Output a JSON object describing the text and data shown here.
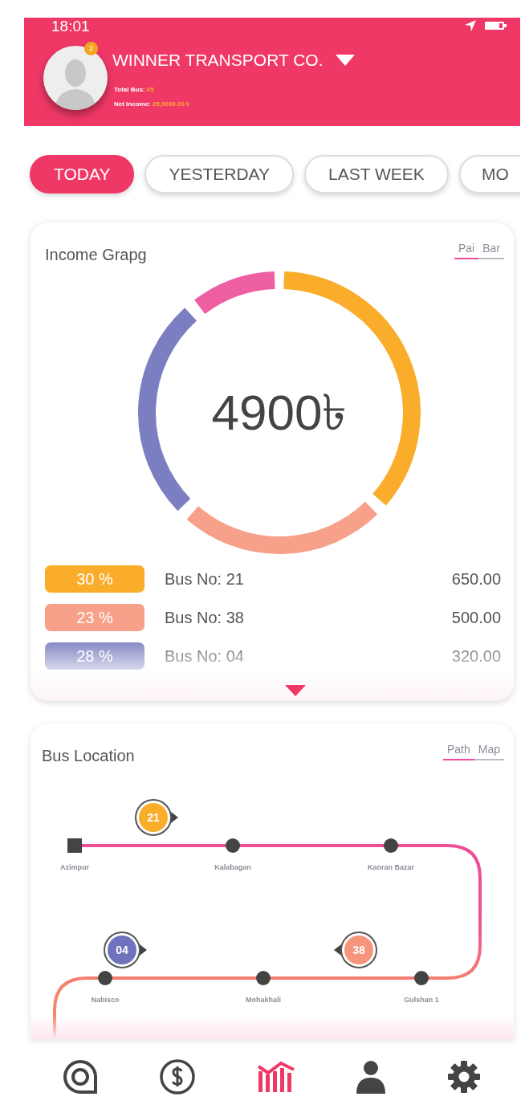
{
  "status_bar": {
    "time": "18:01"
  },
  "header": {
    "company": "WINNER TRANSPORT CO.",
    "notification_count": "2",
    "total_bus_label": "Total Bus:",
    "total_bus": "05",
    "net_income_label": "Net Income:",
    "net_income": "25,0000.00 ৳"
  },
  "period_tabs": [
    {
      "label": "TODAY",
      "selected": true
    },
    {
      "label": "YESTERDAY",
      "selected": false
    },
    {
      "label": "LAST WEEK",
      "selected": false
    },
    {
      "label": "MO",
      "selected": false
    }
  ],
  "income_card": {
    "title": "Income Grapg",
    "view_toggle": [
      {
        "label": "Pai",
        "selected": true
      },
      {
        "label": "Bar",
        "selected": false
      }
    ],
    "total": "4900৳",
    "legend": [
      {
        "percent": "30 %",
        "bus": "Bus No: 21",
        "amount": "650.00",
        "color": "#f9ad2b"
      },
      {
        "percent": "23 %",
        "bus": "Bus No: 38",
        "amount": "500.00",
        "color": "#f7a08a"
      },
      {
        "percent": "28 %",
        "bus": "Bus No: 04",
        "amount": "320.00",
        "color": "#7b7ec0"
      }
    ]
  },
  "bus_location_card": {
    "title": "Bus Location",
    "view_toggle": [
      {
        "label": "Path",
        "selected": true
      },
      {
        "label": "Map",
        "selected": false
      }
    ],
    "stops": [
      {
        "name": "Azimpur"
      },
      {
        "name": "Kalabagan"
      },
      {
        "name": "Kaoran Bazar"
      },
      {
        "name": "Nabisco"
      },
      {
        "name": "Mohakhali"
      },
      {
        "name": "Gulshan 1"
      }
    ],
    "buses": [
      {
        "number": "21",
        "color": "#f9ad2b"
      },
      {
        "number": "04",
        "color": "#6f72bd"
      },
      {
        "number": "38",
        "color": "#f6957c"
      }
    ]
  },
  "bottom_nav": [
    {
      "kind": "location",
      "selected": false
    },
    {
      "kind": "money",
      "selected": false
    },
    {
      "kind": "chart",
      "selected": true
    },
    {
      "kind": "profile",
      "selected": false
    },
    {
      "kind": "settings",
      "selected": false
    }
  ]
}
